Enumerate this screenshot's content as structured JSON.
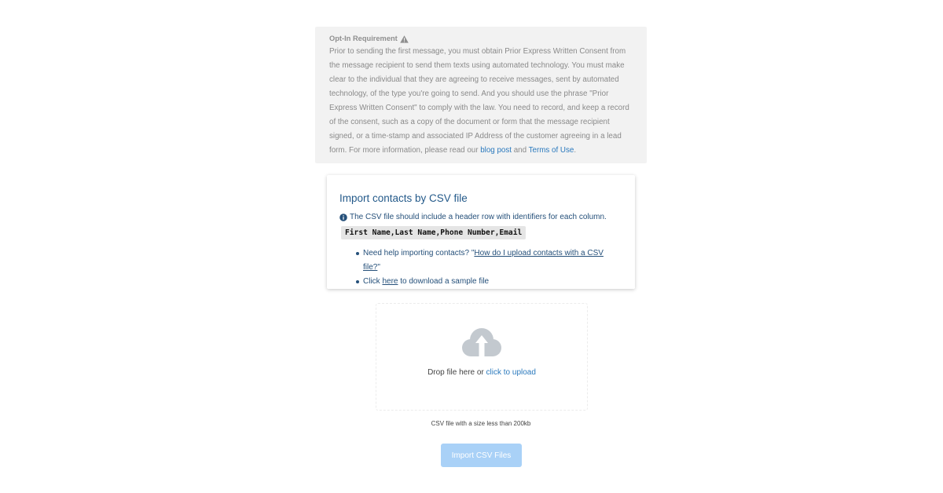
{
  "optin": {
    "title": "Opt-In Requirement",
    "icon": "warning-icon",
    "body_text": "Prior to sending the first message, you must obtain Prior Express Written Consent from the message recipient to send them texts using automated technology. You must make clear to the individual that they are agreeing to receive messages, sent by automated technology, of the type you're going to send. And you should use the phrase \"Prior Express Written Consent\" to comply with the law. You need to record, and keep a record of the consent, such as a copy of the document or form that the message recipient signed, or a time-stamp and associated IP Address of the customer agreeing in a lead form. For more information, please read our",
    "blog_link": "blog post",
    "and_text": "and",
    "terms_link": "Terms of Use",
    "end_text": "."
  },
  "import_card": {
    "title": "Import contacts by CSV file",
    "info_icon": "info-circle-icon",
    "info_text": "The CSV file should include a header row with identifiers for each column.",
    "header_example": "First Name,Last Name,Phone Number,Email",
    "help_prefix": "Need help importing contacts? \"",
    "help_link": "How do I upload contacts with a CSV file?",
    "help_suffix": "\"",
    "sample_prefix": "Click",
    "sample_link": "here",
    "sample_suffix": "to download a sample file"
  },
  "dropzone": {
    "icon": "cloud-upload-icon",
    "drop_text": "Drop file here or",
    "upload_link": "click to upload"
  },
  "size_note": "CSV file with a size less than 200kb",
  "import_button": "Import CSV Files",
  "colors": {
    "link": "#2a79bd",
    "card_text": "#25507a",
    "button_disabled": "#a9d1f7",
    "notice_bg": "#f2f2f2"
  }
}
